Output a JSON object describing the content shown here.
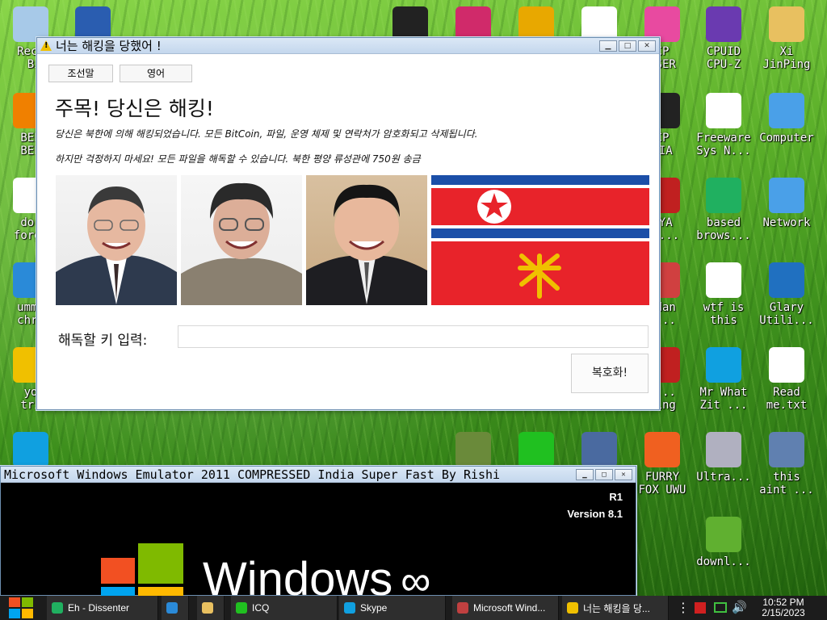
{
  "desktop_icons": [
    {
      "id": "recycle",
      "label": "Recy\n Bi",
      "icon": "recycle-bin-icon",
      "color": "#a7c9e8"
    },
    {
      "id": "virtualbox",
      "label": "",
      "icon": "virtualbox-icon",
      "color": "#2a5db0"
    },
    {
      "id": "skull",
      "label": "",
      "icon": "skull-icon",
      "color": "#222222"
    },
    {
      "id": "film",
      "label": "",
      "icon": "film-icon",
      "color": "#d02a6a"
    },
    {
      "id": "de",
      "label": "",
      "icon": "de-icon",
      "color": "#e8a800"
    },
    {
      "id": "hxd",
      "label": "",
      "icon": "hxd-icon",
      "color": "#ffffff"
    },
    {
      "id": "pinwheel",
      "label": "CP\nWSER",
      "icon": "pinwheel-icon",
      "color": "#e84aa0"
    },
    {
      "id": "cpuz",
      "label": "CPUID\nCPU-Z",
      "icon": "cpuz-icon",
      "color": "#6a3ab0"
    },
    {
      "id": "xi",
      "label": "Xi\nJinPing",
      "icon": "folder-user-icon",
      "color": "#e8c060"
    },
    {
      "id": "vlc",
      "label": "BEE\nBEE",
      "icon": "vlc-icon",
      "color": "#f08000"
    },
    {
      "id": "cp-pia",
      "label": "CP\nPIA",
      "icon": "pia-icon",
      "color": "#222222"
    },
    {
      "id": "freeware",
      "label": "Freeware\nSys N...",
      "icon": "document-icon",
      "color": "#ffffff"
    },
    {
      "id": "computer",
      "label": "Computer",
      "icon": "computer-icon",
      "color": "#4aa0e8"
    },
    {
      "id": "dor",
      "label": "dor\nforge",
      "icon": "window-app-icon",
      "color": "#ffffff"
    },
    {
      "id": "tya",
      "label": "TYA\nE0...",
      "icon": "red-app-icon",
      "color": "#c02020"
    },
    {
      "id": "based",
      "label": "based\nbrows...",
      "icon": "chat-icon",
      "color": "#20b060"
    },
    {
      "id": "network",
      "label": "Network",
      "icon": "network-icon",
      "color": "#4aa0e8"
    },
    {
      "id": "chrome",
      "label": "ummm\nchro",
      "icon": "chrome-icon",
      "color": "#2a8ad8"
    },
    {
      "id": "ndan",
      "label": "ndan\nc...",
      "icon": "clown-icon",
      "color": "#d04040"
    },
    {
      "id": "wtf",
      "label": "wtf is\nthis",
      "icon": "window-app-icon",
      "color": "#ffffff"
    },
    {
      "id": "glary",
      "label": "Glary\nUtili...",
      "icon": "glary-icon",
      "color": "#2070c0"
    },
    {
      "id": "star",
      "label": "yo\ntri",
      "icon": "star-icon",
      "color": "#f0c000"
    },
    {
      "id": "santa",
      "label": "h...\nling",
      "icon": "santa-icon",
      "color": "#c02020"
    },
    {
      "id": "mrwhat",
      "label": "Mr What\nZit ...",
      "icon": "skype-icon",
      "color": "#10a0e0"
    },
    {
      "id": "readme",
      "label": "Read\nme.txt",
      "icon": "text-file-icon",
      "color": "#ffffff"
    },
    {
      "id": "skype2",
      "label": "",
      "icon": "skype-icon",
      "color": "#10a0e0"
    },
    {
      "id": "mc",
      "label": "",
      "icon": "minecraft-icon",
      "color": "#6a8a3a"
    },
    {
      "id": "icq",
      "label": "",
      "icon": "icq-icon",
      "color": "#20c020"
    },
    {
      "id": "pc",
      "label": "",
      "icon": "pc-icon",
      "color": "#4a6aa0"
    },
    {
      "id": "furry",
      "label": "FURRY\nFOX UWU",
      "icon": "firefox-icon",
      "color": "#f06020"
    },
    {
      "id": "ultra",
      "label": "Ultra...",
      "icon": "disc-icon",
      "color": "#b0b0c0"
    },
    {
      "id": "thisaint",
      "label": "this\naint ...",
      "icon": "printer-icon",
      "color": "#6080b0"
    },
    {
      "id": "downl",
      "label": "downl...",
      "icon": "image-icon",
      "color": "#60b030"
    }
  ],
  "ransom_window": {
    "title": "너는 해킹을 당했어 !",
    "tab_korean": "조선말",
    "tab_english": "영어",
    "heading": "주목! 당신은 해킹!",
    "line1": "당신은 북한에 의해 해킹되었습니다. 모든 BitCoin, 파일, 운영 체제 및 연락처가 암호화되고 삭제됩니다.",
    "line2": "하지만 걱정하지 마세요! 모든 파일을 해독할 수 있습니다. 북한 평양 류성관에 750원 송금",
    "key_label": "해독할 키 입력:",
    "key_value": "",
    "decrypt_button": "복호화!",
    "minimize": "▁",
    "maximize": "□",
    "close": "✕"
  },
  "emulator_window": {
    "title": "Microsoft Windows Emulator 2011 COMPRESSED India Super Fast By Rishi",
    "r1": "R1",
    "version": "Version 8.1",
    "logo_text": "Windows",
    "logo_suffix": "∞",
    "minimize": "▁",
    "maximize": "□",
    "close": "✕"
  },
  "taskbar": {
    "items": [
      {
        "label": "Eh - Dissenter",
        "icon": "dissenter-icon",
        "color": "#20b060"
      },
      {
        "label": "",
        "icon": "chrome-icon",
        "color": "#2a8ad8"
      },
      {
        "label": "",
        "icon": "folder-icon",
        "color": "#e8c060"
      },
      {
        "label": "ICQ",
        "icon": "icq-icon",
        "color": "#20c020"
      },
      {
        "label": "Skype",
        "icon": "skype-icon",
        "color": "#10a0e0"
      },
      {
        "label": "Microsoft Wind...",
        "icon": "window-app-icon",
        "color": "#c04040"
      },
      {
        "label": "너는 해킹을 당...",
        "icon": "warning-icon",
        "color": "#f0c000"
      }
    ],
    "time": "10:52 PM",
    "date": "2/15/2023"
  }
}
